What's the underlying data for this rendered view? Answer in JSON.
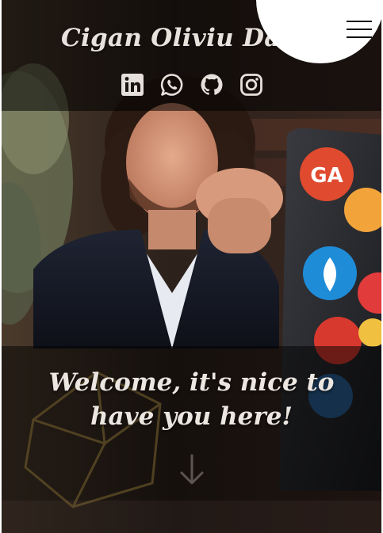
{
  "header": {
    "title": "Cigan Oliviu David",
    "socials": [
      {
        "icon": "linkedin-icon"
      },
      {
        "icon": "whatsapp-icon"
      },
      {
        "icon": "github-icon"
      },
      {
        "icon": "instagram-icon"
      }
    ]
  },
  "menu": {
    "icon": "hamburger-menu-icon"
  },
  "hero": {
    "welcome": "Welcome, it's nice to have you here!",
    "scroll_icon": "arrow-down-icon"
  },
  "laptop": {
    "sticker_text": "GA"
  },
  "colors": {
    "title_text": "#e8e2dc",
    "band_overlay": "#000000",
    "menu_bg": "#ffffff",
    "icon_color": "#e6e0da"
  }
}
